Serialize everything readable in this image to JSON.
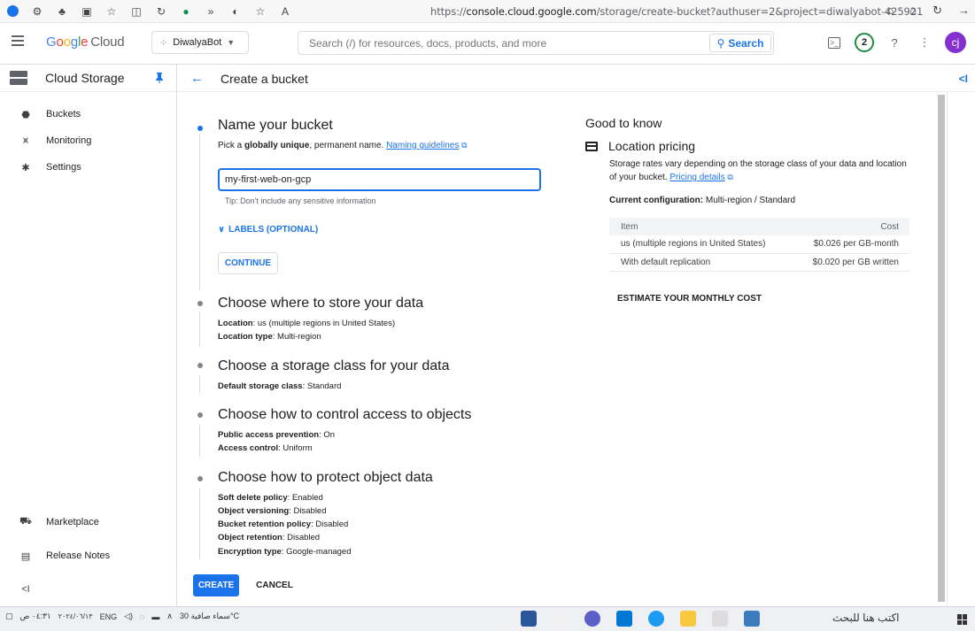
{
  "browser": {
    "url_prefix": "https://",
    "url_domain": "console.cloud.google.com",
    "url_path": "/storage/create-bucket?authuser=2&project=diwalyabot-425921"
  },
  "header": {
    "logo_google": [
      "G",
      "o",
      "o",
      "g",
      "l",
      "e"
    ],
    "logo_cloud": "Cloud",
    "project": "DiwalyaBot",
    "search_placeholder": "Search (/) for resources, docs, products, and more",
    "search_button": "Search",
    "notif_count": "2",
    "avatar_initials": "cj"
  },
  "sidebar": {
    "title": "Cloud Storage",
    "items": [
      {
        "label": "Buckets",
        "icon": "bucket-icon"
      },
      {
        "label": "Monitoring",
        "icon": "monitoring-icon"
      },
      {
        "label": "Settings",
        "icon": "settings-icon"
      }
    ],
    "bottom_items": [
      {
        "label": "Marketplace",
        "icon": "cart-icon"
      },
      {
        "label": "Release Notes",
        "icon": "notes-icon"
      }
    ],
    "collapse": "<I"
  },
  "page": {
    "title": "Create a bucket",
    "collapse_right": "<I"
  },
  "step1": {
    "title": "Name your bucket",
    "desc_pre": "Pick a ",
    "desc_bold": "globally unique",
    "desc_post": ", permanent name. ",
    "desc_link": "Naming guidelines",
    "input_value": "my-first-web-on-gcp",
    "tip": "Tip: Don't include any sensitive information",
    "labels_toggle": "LABELS (OPTIONAL)",
    "continue": "CONTINUE"
  },
  "step2": {
    "title": "Choose where to store your data",
    "l1_key": "Location",
    "l1_val": ": us (multiple regions in United States)",
    "l2_key": "Location type",
    "l2_val": ": Multi-region"
  },
  "step3": {
    "title": "Choose a storage class for your data",
    "l1_key": "Default storage class",
    "l1_val": ": Standard"
  },
  "step4": {
    "title": "Choose how to control access to objects",
    "l1_key": "Public access prevention",
    "l1_val": ": On",
    "l2_key": "Access control",
    "l2_val": ": Uniform"
  },
  "step5": {
    "title": "Choose how to protect object data",
    "l1_key": "Soft delete policy",
    "l1_val": ": Enabled",
    "l2_key": "Object versioning",
    "l2_val": ": Disabled",
    "l3_key": "Bucket retention policy",
    "l3_val": ": Disabled",
    "l4_key": "Object retention",
    "l4_val": ": Disabled",
    "l5_key": "Encryption type",
    "l5_val": ": Google-managed"
  },
  "actions": {
    "create": "CREATE",
    "cancel": "CANCEL"
  },
  "good_to_know": {
    "title": "Good to know",
    "loc_title": "Location pricing",
    "loc_desc": "Storage rates vary depending on the storage class of your data and location of your bucket. ",
    "loc_link": "Pricing details",
    "cur_cfg_key": "Current configuration:",
    "cur_cfg_val": " Multi-region / Standard",
    "table_headers": [
      "Item",
      "Cost"
    ],
    "table_rows": [
      [
        "us (multiple regions in United States)",
        "$0.026 per GB-month"
      ],
      [
        "With default replication",
        "$0.020 per GB written"
      ]
    ],
    "estimate": "ESTIMATE YOUR MONTHLY COST"
  },
  "taskbar": {
    "time": "٠٤:٣١ ص",
    "date": "٢٠٢٤/٠٦/١٣",
    "lang": "ENG",
    "weather": "سماء صافية  30°C",
    "search": "اكتب هنا للبحث"
  }
}
